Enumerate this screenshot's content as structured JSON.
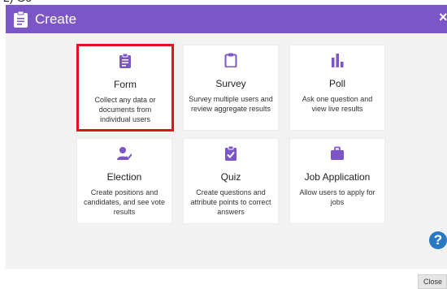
{
  "header": {
    "title": "Create",
    "close_glyph": "×"
  },
  "cards": [
    {
      "label": "Form",
      "desc": "Collect any data or documents from individual users",
      "icon": "clipboard-list-icon"
    },
    {
      "label": "Survey",
      "desc": "Survey multiple users and review aggregate results",
      "icon": "clipboard-outline-icon"
    },
    {
      "label": "Poll",
      "desc": "Ask one question and view live results",
      "icon": "bar-chart-icon"
    },
    {
      "label": "Election",
      "desc": "Create positions and candidates, and see vote results",
      "icon": "person-check-icon"
    },
    {
      "label": "Quiz",
      "desc": "Create questions and attribute points to correct answers",
      "icon": "clipboard-check-icon"
    },
    {
      "label": "Job Application",
      "desc": "Allow users to apply for jobs",
      "icon": "briefcase-icon"
    }
  ],
  "selected_card": "Form",
  "help": {
    "glyph": "?"
  },
  "footer": {
    "close_label": "Close"
  },
  "colors": {
    "accent": "#7c55c7",
    "selected_border": "#e0141e",
    "help": "#2a79c5",
    "background": "#f2f2f2"
  }
}
